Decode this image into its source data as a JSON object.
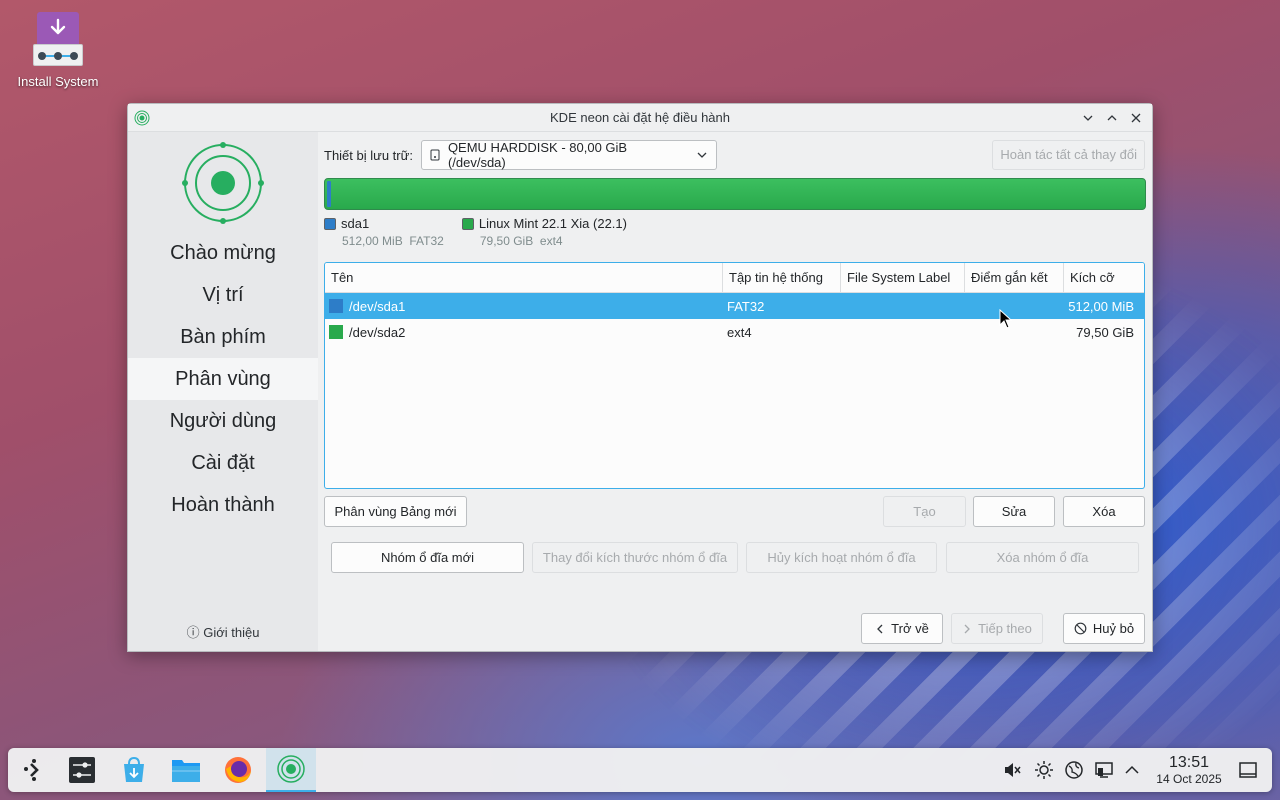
{
  "desktop": {
    "icon_label": "Install System"
  },
  "window": {
    "title": "KDE neon cài đặt hệ điều hành",
    "controls": [
      "chevron-down-icon",
      "chevron-up-icon",
      "close-icon"
    ]
  },
  "sidebar": {
    "steps": [
      "Chào mừng",
      "Vị trí",
      "Bàn phím",
      "Phân vùng",
      "Người dùng",
      "Cài đặt",
      "Hoàn thành"
    ],
    "active_index": 3,
    "about": "Giới thiệu"
  },
  "storage": {
    "label": "Thiết bị lưu trữ:",
    "device": "QEMU HARDDISK - 80,00 GiB (/dev/sda)",
    "undo_all": "Hoàn tác tất cả thay đổi"
  },
  "legend": [
    {
      "name": "sda1",
      "size": "512,00 MiB",
      "fs": "FAT32",
      "color": "#2d7dc8"
    },
    {
      "name": "Linux Mint 22.1 Xia (22.1)",
      "size": "79,50 GiB",
      "fs": "ext4",
      "color": "#29a94c"
    }
  ],
  "table": {
    "headers": [
      "Tên",
      "Tập tin hệ thống",
      "File System Label",
      "Điểm gắn kết",
      "Kích cỡ"
    ],
    "rows": [
      {
        "name": "/dev/sda1",
        "fs": "FAT32",
        "label": "",
        "mount": "",
        "size": "512,00 MiB",
        "color": "#2d7dc8",
        "selected": true
      },
      {
        "name": "/dev/sda2",
        "fs": "ext4",
        "label": "",
        "mount": "",
        "size": "79,50 GiB",
        "color": "#29a94c",
        "selected": false
      }
    ]
  },
  "buttons": {
    "new_table": "Phân vùng Bảng mới",
    "create": "Tạo",
    "edit": "Sửa",
    "delete": "Xóa",
    "new_vg": "Nhóm ổ đĩa mới",
    "resize_vg": "Thay đổi kích thước nhóm ổ đĩa",
    "deactivate_vg": "Hủy kích hoạt nhóm ổ đĩa",
    "remove_vg": "Xóa nhóm ổ đĩa",
    "back": "Trở về",
    "next": "Tiếp theo",
    "cancel": "Huỷ bỏ"
  },
  "taskbar": {
    "time": "13:51",
    "date": "14 Oct 2025",
    "apps": [
      "launcher-icon",
      "settings-icon",
      "discover-icon",
      "files-icon",
      "firefox-icon",
      "installer-icon"
    ],
    "tray": [
      "muted-speaker-icon",
      "brightness-icon",
      "network-icon",
      "display-icon",
      "expand-tray-icon"
    ]
  }
}
